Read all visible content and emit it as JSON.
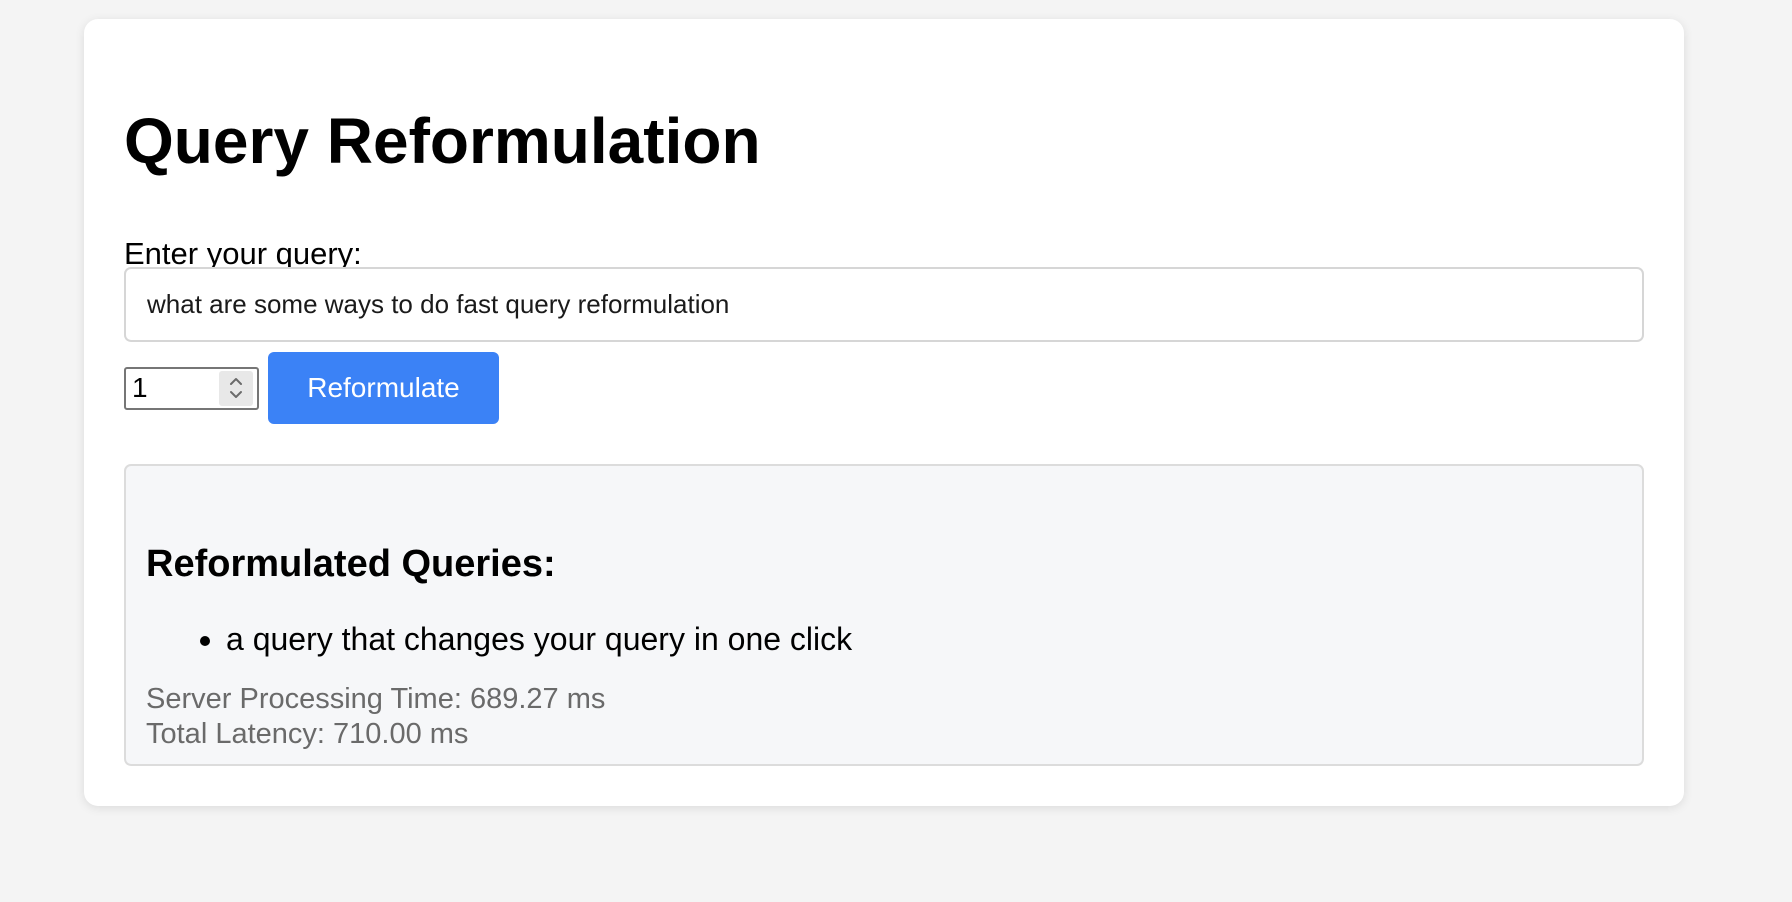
{
  "page": {
    "title": "Query Reformulation"
  },
  "form": {
    "query_label": "Enter your query:",
    "query_value": "what are some ways to do fast query reformulation",
    "count_value": "1",
    "submit_label": "Reformulate"
  },
  "results": {
    "heading": "Reformulated Queries:",
    "items": [
      "a query that changes your query in one click"
    ],
    "server_time": "Server Processing Time: 689.27 ms",
    "total_latency": "Total Latency: 710.00 ms"
  },
  "colors": {
    "accent": "#3b82f6",
    "page_bg": "#f4f4f4",
    "results_bg": "#f6f7f9"
  }
}
